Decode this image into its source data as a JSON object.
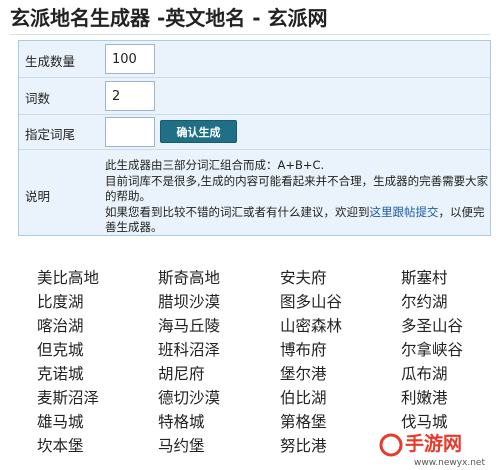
{
  "page": {
    "title": "玄派地名生成器 -英文地名 - 玄派网"
  },
  "form": {
    "count_label": "生成数量",
    "count_value": "100",
    "words_label": "词数",
    "words_value": "2",
    "suffix_label": "指定词尾",
    "suffix_value": "",
    "confirm_button": "确认生成",
    "note_label": "说明",
    "note_line1": "此生成器由三部分词汇组合而成：A+B+C.",
    "note_line2": "目前词库不是很多,生成的内容可能看起来并不合理，生成器的完善需要大家的帮助。",
    "note_line3_before": "如果您看到比较不错的词汇或者有什么建议，欢迎到",
    "note_link": "这里跟帖提交",
    "note_line3_after": "，以便完善生成器。"
  },
  "results": [
    [
      "美比高地",
      "斯奇高地",
      "安夫府",
      "斯塞村"
    ],
    [
      "比度湖",
      "腊坝沙漠",
      "图多山谷",
      "尔约湖"
    ],
    [
      "喀治湖",
      "海马丘陵",
      "山密森林",
      "多圣山谷"
    ],
    [
      "但克城",
      "班科沼泽",
      "博布府",
      "尔拿峡谷"
    ],
    [
      "克诺城",
      "胡尼府",
      "堡尔港",
      "瓜布湖"
    ],
    [
      "麦斯沼泽",
      "德切沙漠",
      "伯比湖",
      "利嫩港"
    ],
    [
      "雄马城",
      "特格城",
      "第格堡",
      "伐马城"
    ],
    [
      "坎本堡",
      "马约堡",
      "努比港",
      ""
    ]
  ],
  "watermark": {
    "brand": "手游网",
    "url": "www.newyx.net",
    "accent": "#e8392b"
  }
}
